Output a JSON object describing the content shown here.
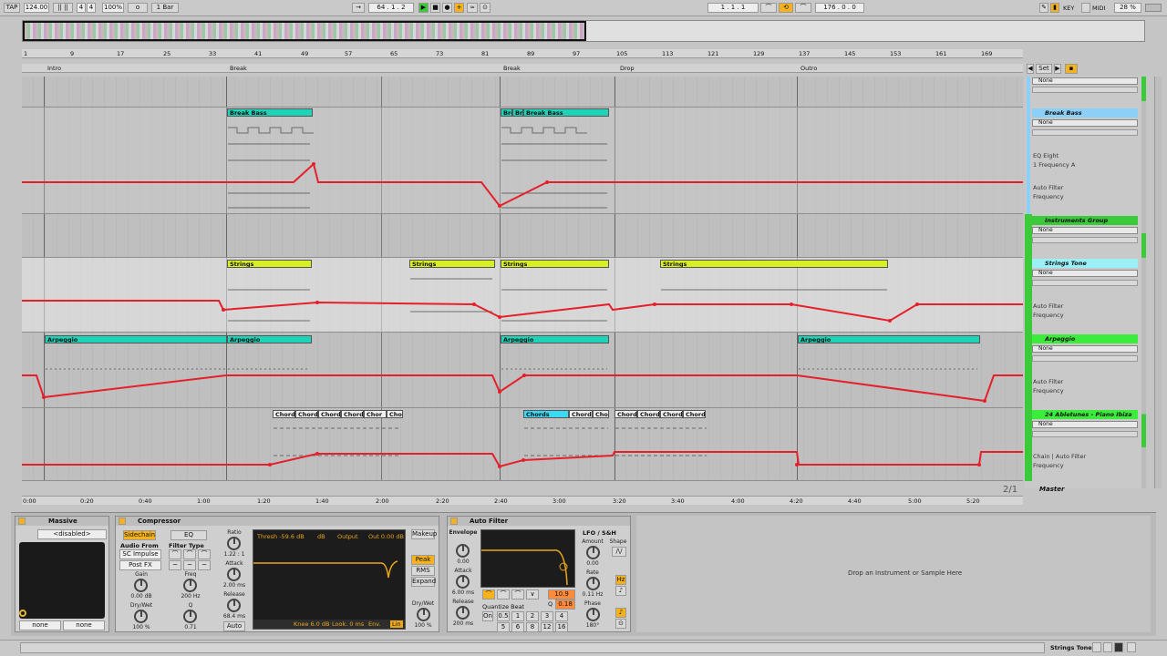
{
  "toolbar": {
    "tap": "TAP",
    "tempo": "124.00",
    "sig_num": "4",
    "sig_den": "4",
    "zoom": "100%",
    "metronome_icon": "o",
    "quantize": "1 Bar",
    "position": "64 . 1 . 2",
    "loop_start": "1 . 1 . 1",
    "loop_length": "176 . 0 . 0",
    "key": "KEY",
    "midi": "MIDI",
    "cpu": "28 %"
  },
  "ruler": {
    "bars": [
      "1",
      "9",
      "17",
      "25",
      "33",
      "41",
      "49",
      "57",
      "65",
      "73",
      "81",
      "89",
      "97",
      "105",
      "113",
      "121",
      "129",
      "137",
      "145",
      "153",
      "161",
      "169"
    ],
    "times": [
      "0:00",
      "0:20",
      "0:40",
      "1:00",
      "1:20",
      "1:40",
      "2:00",
      "2:20",
      "2:40",
      "3:00",
      "3:20",
      "3:40",
      "4:00",
      "4:20",
      "4:40",
      "5:00",
      "5:20"
    ],
    "locators": [
      "Intro",
      "Break",
      "Break",
      "Drop",
      "Outro"
    ],
    "set_button": "Set",
    "page": "2/1"
  },
  "clips": {
    "break_bass": "Break Bass",
    "break_bass_short1": "Bre",
    "break_bass_short2": "Bre",
    "strings": "Strings",
    "arpeggio": "Arpeggio",
    "chords": "Chords",
    "chords_short": "Chor"
  },
  "tracks": [
    {
      "name": "Break Bass",
      "device": "None",
      "param1": "EQ Eight",
      "param2": "1 Frequency A",
      "param3": "Auto Filter",
      "param4": "Frequency"
    },
    {
      "name": "Instruments Group",
      "device": "None"
    },
    {
      "name": "Strings Tone",
      "device": "None",
      "param1": "Auto Filter",
      "param2": "Frequency"
    },
    {
      "name": "Arpeggio",
      "device": "None",
      "param1": "Auto Filter",
      "param2": "Frequency"
    },
    {
      "name": "24 Abletunes - Piano Ibiza",
      "device": "None",
      "param1": "Chain | Auto Filter",
      "param2": "Frequency"
    },
    {
      "name": "Master"
    }
  ],
  "top_device": "None",
  "devices": {
    "massive": {
      "title": "Massive",
      "preset": "<disabled>",
      "in1": "none",
      "in2": "none"
    },
    "compressor": {
      "title": "Compressor",
      "sidechain": "Sidechain",
      "eq": "EQ",
      "audio_from": "Audio From",
      "source": "SC Impulse",
      "post": "Post FX",
      "filter_type": "Filter Type",
      "gain_label": "Gain",
      "gain": "0.00 dB",
      "freq_label": "Freq",
      "freq": "200 Hz",
      "drywet_label": "Dry/Wet",
      "drywet": "100 %",
      "q_label": "Q",
      "q": "0.71",
      "ratio_label": "Ratio",
      "ratio": "1.22 : 1",
      "attack_label": "Attack",
      "attack": "2.00 ms",
      "release_label": "Release",
      "release": "68.4 ms",
      "auto": "Auto",
      "thresh": "Thresh -59.6 dB",
      "gr": "dB",
      "output": "Output",
      "out": "Out 0.00 dB",
      "makeup": "Makeup",
      "peak": "Peak",
      "rms": "RMS",
      "expand": "Expand",
      "knee": "Knee 6.0 dB",
      "look": "Look. 0 ms",
      "env": "Env.",
      "lin": "Lin",
      "drywet2_label": "Dry/Wet",
      "drywet2": "100 %"
    },
    "autofilter": {
      "title": "Auto Filter",
      "envelope": "Envelope",
      "env_val": "0.00",
      "attack_label": "Attack",
      "attack": "6.00 ms",
      "release_label": "Release",
      "release": "200 ms",
      "freq": "10.9 kHz",
      "q_label": "Q",
      "q": "0.18",
      "quantize": "Quantize Beat",
      "on": "On",
      "q_vals": [
        "0.5",
        "1",
        "2",
        "3",
        "4",
        "5",
        "6",
        "8",
        "12",
        "16"
      ],
      "lfo": "LFO / S&H",
      "amount_label": "Amount",
      "amount": "0.00",
      "shape": "Shape",
      "rate_label": "Rate",
      "rate": "0.11 Hz",
      "phase_label": "Phase",
      "phase": "180°",
      "hz": "Hz"
    },
    "drop_hint": "Drop an Instrument or Sample Here"
  },
  "status": {
    "track": "Strings Tone"
  },
  "colors": {
    "accent": "#f5b21a",
    "automation": "#e5202a",
    "group": "#3aca3a",
    "teal_clip": "#1ed3b8",
    "yellow_clip": "#d9ef25",
    "selected_header": "#8ccff8"
  }
}
